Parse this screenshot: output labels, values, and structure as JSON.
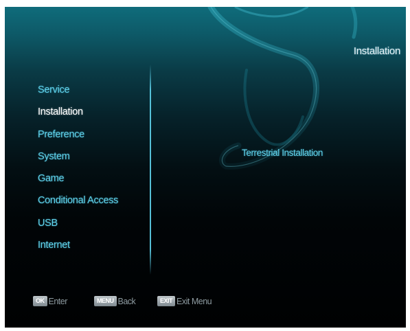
{
  "header": {
    "title": "Installation"
  },
  "menu": {
    "items": [
      {
        "label": "Service",
        "selected": false
      },
      {
        "label": "Installation",
        "selected": true
      },
      {
        "label": "Preference",
        "selected": false
      },
      {
        "label": "System",
        "selected": false
      },
      {
        "label": "Game",
        "selected": false
      },
      {
        "label": "Conditional Access",
        "selected": false
      },
      {
        "label": "USB",
        "selected": false
      },
      {
        "label": "Internet",
        "selected": false
      }
    ]
  },
  "submenu": {
    "items": [
      {
        "label": "Terrestrial Installation"
      }
    ]
  },
  "footer": {
    "ok_key": "OK",
    "ok_label": "Enter",
    "menu_key": "MENU",
    "menu_label": "Back",
    "exit_key": "EXIT",
    "exit_label": "Exit Menu"
  },
  "colors": {
    "accent": "#5fd3ec",
    "selected": "#ffffff",
    "hint": "#8e9ca2",
    "background_top": "#0f6c7b",
    "background_bottom": "#000102"
  },
  "icons": {
    "background_logo": "swan-s-logo"
  }
}
